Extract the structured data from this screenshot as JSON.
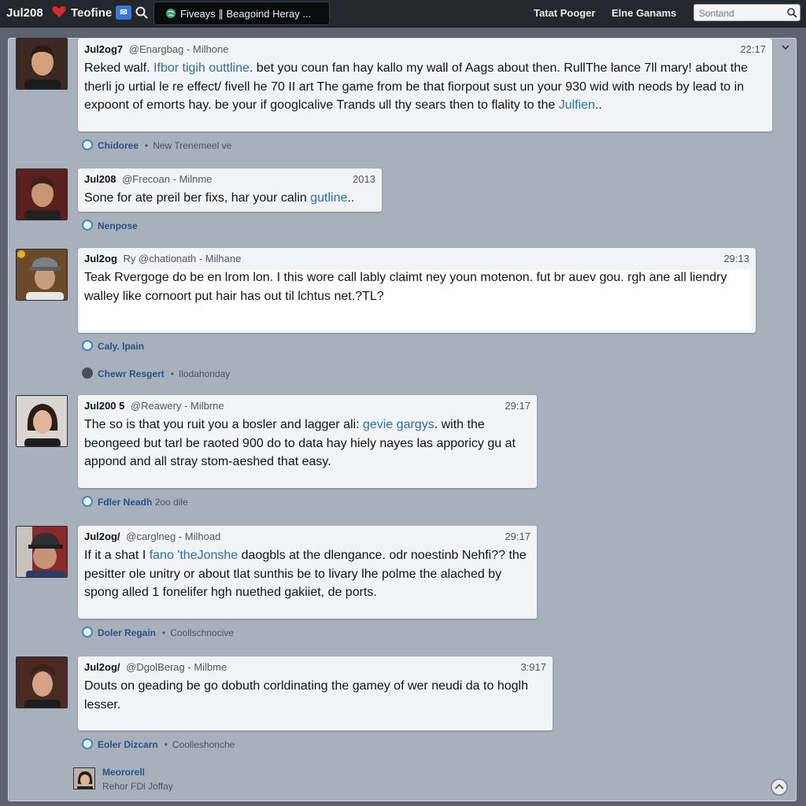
{
  "topbar": {
    "user": "Jul208",
    "tab": "Teofine",
    "pill_text": "Fiveays ∥ Beagoind Heray ...",
    "link1": "Tatat Pooger",
    "link2": "Elne Ganams",
    "search_placeholder": "Sontand"
  },
  "posts": [
    {
      "name": "Jul2og7",
      "handle": "@Enargbag",
      "place": "- Milhone",
      "time": "22:17",
      "body_a": "Reked walf. ",
      "body_hl": "Ifbor tigih outtline",
      "body_b": ". bet you coun fan hay kallo my wall of Aags about then. RullThe lance 7ll mary! about the therli jo urtial le re effect/ fivell he 70 II art The game from be that fiorpout sust un your 930 wid with neods by lead to in expoont of emorts hay. be your if googlcalive Trands ull thy sears then to flality to the ",
      "body_hl2": "Julfien",
      "body_c": "..",
      "meta_actor": "Chidoree",
      "meta_sub": "New Trenemeel ve"
    },
    {
      "name": "Jul208",
      "handle": "@Frecoan",
      "place": "- Milnme",
      "time": "2013",
      "body_a": "Sone for ate preil ber fixs, har your calin ",
      "body_hl": "gutline",
      "body_b": "..",
      "meta_actor": "Nenpose"
    },
    {
      "name": "Jul2og",
      "handle": "Ry @chationath",
      "place": "- Milhane",
      "time": "29:13",
      "body_a": "Teak Rvergoge do be en lrom lon. I this wore call lably claimt ney youn motenon. fut br auev gou. rgh ane all liendry walley like cornoort put hair has out til lchtus net.?TL?",
      "meta_actor": "Caly. lpain",
      "meta2_actor": "Chewr Resgert",
      "meta2_sub": "Ilodahonday"
    },
    {
      "name": "Jul200 5",
      "handle": "@Reawery",
      "place": "- Milbrne",
      "time": "29:17",
      "body_a": "The so is that you ruit you a bosler and lagger ali: ",
      "body_hl": "gevie gargys",
      "body_b": ". with the beongeed but tarl be raoted 900 do to data hay hiely nayes las apporicy gu at appond and all stray stom-aeshed that easy.",
      "meta_actor": "Fdler Neadh",
      "meta_sub": "2oo dile"
    },
    {
      "name": "Jul2og/",
      "handle": "@carglneg",
      "place": "- Milhoad",
      "time": "29:17",
      "body_a": "If it a shat I ",
      "body_hl": "fano 'theJonshe",
      "body_b": " daogbls at the dlengance. odr noestinb Nehfi?? the pesitter ole unitry or about tlat sunthis be to livary lhe polme the alached by spong alled 1 fonelifer hgh nuethed gakiiet, de ports.",
      "meta_actor": "Doler Regain",
      "meta_sub": "Coollschnocive"
    },
    {
      "name": "Jul2og/",
      "handle": "@DgolBerag",
      "place": "- Milbme",
      "time": "3:917",
      "body_a": "Douts on geading be go dobuth corldinating the gamey of wer neudi da to hoglh lesser.",
      "meta_actor": "Eoler Dizcarn",
      "meta_sub": "Coolleshonche"
    }
  ],
  "footer": {
    "name": "Meororell",
    "sub": "Rehor FDl Joffay"
  }
}
